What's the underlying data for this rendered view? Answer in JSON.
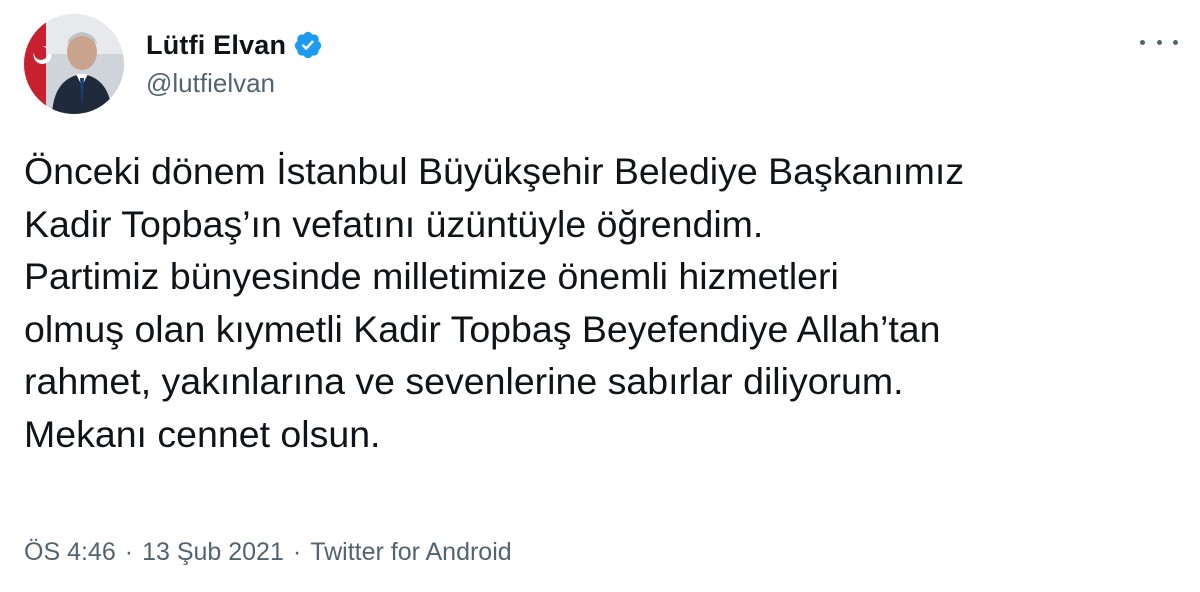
{
  "author": {
    "display_name": "Lütfi Elvan",
    "handle": "@lutfielvan",
    "verified_icon": "verified-badge-icon"
  },
  "tweet": {
    "lines": [
      "Önceki dönem İstanbul Büyükşehir Belediye Başkanımız",
      "Kadir Topbaş’ın vefatını üzüntüyle öğrendim.",
      "Partimiz bünyesinde milletimize önemli hizmetleri",
      "olmuş olan kıymetli Kadir Topbaş Beyefendiye Allah’tan",
      "rahmet, yakınlarına ve sevenlerine sabırlar diliyorum.",
      "Mekanı cennet olsun."
    ]
  },
  "meta": {
    "time": "ÖS 4:46",
    "separator": "·",
    "date": "13 Şub 2021",
    "source": "Twitter for Android"
  },
  "colors": {
    "text": "#0f1419",
    "secondary": "#536471",
    "verified": "#1d9bf0"
  }
}
